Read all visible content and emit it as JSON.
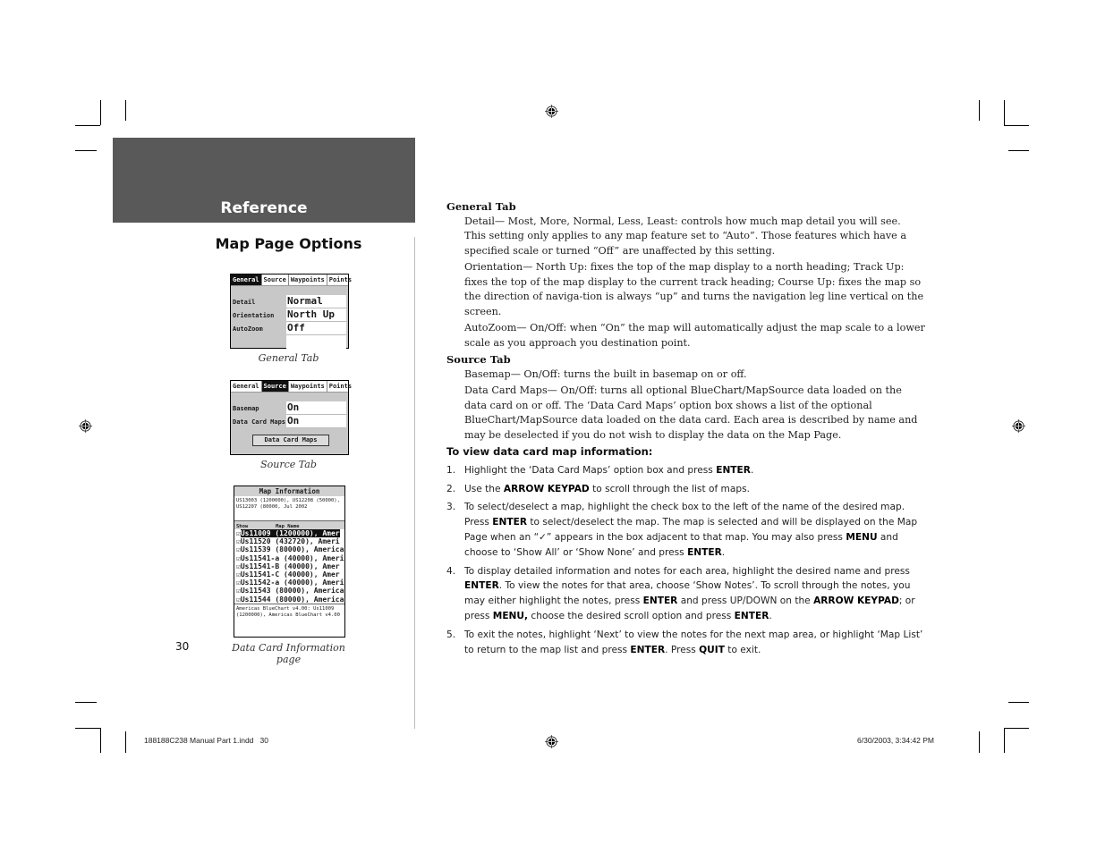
{
  "header": {
    "band_title": "Reference",
    "section_title": "Map Page Options",
    "band_color": "#595959"
  },
  "screens": {
    "general": {
      "tabs": [
        "General",
        "Source",
        "Waypoints",
        "Points"
      ],
      "active_tab": "General",
      "rows": [
        {
          "label": "Detail",
          "value": "Normal"
        },
        {
          "label": "Orientation",
          "value": "North Up"
        },
        {
          "label": "AutoZoom",
          "value": "Off"
        }
      ],
      "caption": "General Tab"
    },
    "source": {
      "tabs": [
        "General",
        "Source",
        "Waypoints",
        "Points"
      ],
      "active_tab": "Source",
      "rows": [
        {
          "label": "Basemap",
          "value": "On"
        },
        {
          "label": "Data Card Maps",
          "value": "On"
        }
      ],
      "button": "Data Card Maps",
      "caption": "Source Tab"
    },
    "map_info": {
      "title": "Map Information",
      "description": "US13003 (1200000), US12208 (50000), US12207 (80000, Jul 2002",
      "col_show": "Show",
      "col_name": "Map Name",
      "items": [
        {
          "checked": "☑",
          "name": "Us11009 (1200000), Amer",
          "selected": true
        },
        {
          "checked": "☑",
          "name": "Us11520 (432720), Ameri",
          "selected": false
        },
        {
          "checked": "☑",
          "name": "Us11539 (80000), America",
          "selected": false
        },
        {
          "checked": "☑",
          "name": "Us11541-a (40000), Ameri",
          "selected": false
        },
        {
          "checked": "☑",
          "name": "Us11541-B (40000), Amer",
          "selected": false
        },
        {
          "checked": "☑",
          "name": "Us11541-C (40000), Amer",
          "selected": false
        },
        {
          "checked": "☑",
          "name": "Us11542-a (40000), Ameri",
          "selected": false
        },
        {
          "checked": "☑",
          "name": "Us11543 (80000), America",
          "selected": false
        },
        {
          "checked": "☑",
          "name": "Us11544 (80000), America",
          "selected": false
        }
      ],
      "notes": "Americas BlueChart v4.00: Us11009 (1200000), Americas BlueChart v4.00",
      "caption": "Data Card Information page"
    }
  },
  "content": {
    "general_tab": {
      "heading": "General Tab",
      "paragraphs": [
        "Detail— Most, More, Normal, Less, Least: controls how much map detail you will see. This setting only applies to any map feature set to “Auto”. Those features which have a specified scale or turned “Off” are unaffected by this setting.",
        "Orientation— North Up: fixes the top of the map display to a north heading; Track Up: fixes the top of the map display to the current track heading; Course Up: fixes the map so the direction of naviga-tion is always “up” and turns the navigation leg line vertical on the screen.",
        "AutoZoom— On/Off: when “On” the map will automatically adjust the map scale to a lower scale as you approach you destination point."
      ]
    },
    "source_tab": {
      "heading": "Source Tab",
      "paragraphs": [
        "Basemap— On/Off: turns the built in basemap on or off.",
        "Data Card Maps— On/Off: turns all optional BlueChart/MapSource data loaded on the data card on or off. The ‘Data Card Maps’ option box shows a list of the optional BlueChart/MapSource data loaded on the data card. Each area is described by name and may be deselected if you do not wish to display the data on the Map Page."
      ]
    },
    "procedure": {
      "heading": "To view data card map information:",
      "steps": [
        {
          "num": "1.",
          "parts": [
            [
              "Highlight the ‘Data Card Maps’ option box and press ",
              false
            ],
            [
              "ENTER",
              true
            ],
            [
              ".",
              false
            ]
          ]
        },
        {
          "num": "2.",
          "parts": [
            [
              "Use the ",
              false
            ],
            [
              "ARROW KEYPAD",
              true
            ],
            [
              " to scroll through the list of maps.",
              false
            ]
          ]
        },
        {
          "num": "3.",
          "parts": [
            [
              "To select/deselect a map, highlight the check box to the left of the name of the desired map. Press ",
              false
            ],
            [
              "ENTER",
              true
            ],
            [
              " to select/deselect the map. The map is selected and will be displayed on the Map Page when an “✓” appears in the box adjacent to that map. You may also press ",
              false
            ],
            [
              "MENU",
              true
            ],
            [
              " and choose to ‘Show All’ or ‘Show None’ and press ",
              false
            ],
            [
              "ENTER",
              true
            ],
            [
              ".",
              false
            ]
          ]
        },
        {
          "num": "4.",
          "parts": [
            [
              "To display detailed information and notes for each area, highlight the desired name and press ",
              false
            ],
            [
              "ENTER",
              true
            ],
            [
              ". To view the notes for that area, choose ‘Show Notes’. To scroll through the notes, you may either highlight the notes, press ",
              false
            ],
            [
              "ENTER",
              true
            ],
            [
              " and press UP/DOWN on the ",
              false
            ],
            [
              "ARROW KEYPAD",
              true
            ],
            [
              "; or press ",
              false
            ],
            [
              "MENU,",
              true
            ],
            [
              " choose the desired scroll option and press ",
              false
            ],
            [
              "ENTER",
              true
            ],
            [
              ".",
              false
            ]
          ]
        },
        {
          "num": "5.",
          "parts": [
            [
              "To exit the notes, highlight ‘Next’ to view the notes for the next map area, or highlight ‘Map List’ to return to the map list and press ",
              false
            ],
            [
              "ENTER",
              true
            ],
            [
              ". Press ",
              false
            ],
            [
              "QUIT",
              true
            ],
            [
              " to exit.",
              false
            ]
          ]
        }
      ]
    }
  },
  "footer": {
    "page_number": "30",
    "file_slug": "188188C238 Manual Part 1.indd   30",
    "timestamp": "6/30/2003, 3:34:42 PM"
  }
}
